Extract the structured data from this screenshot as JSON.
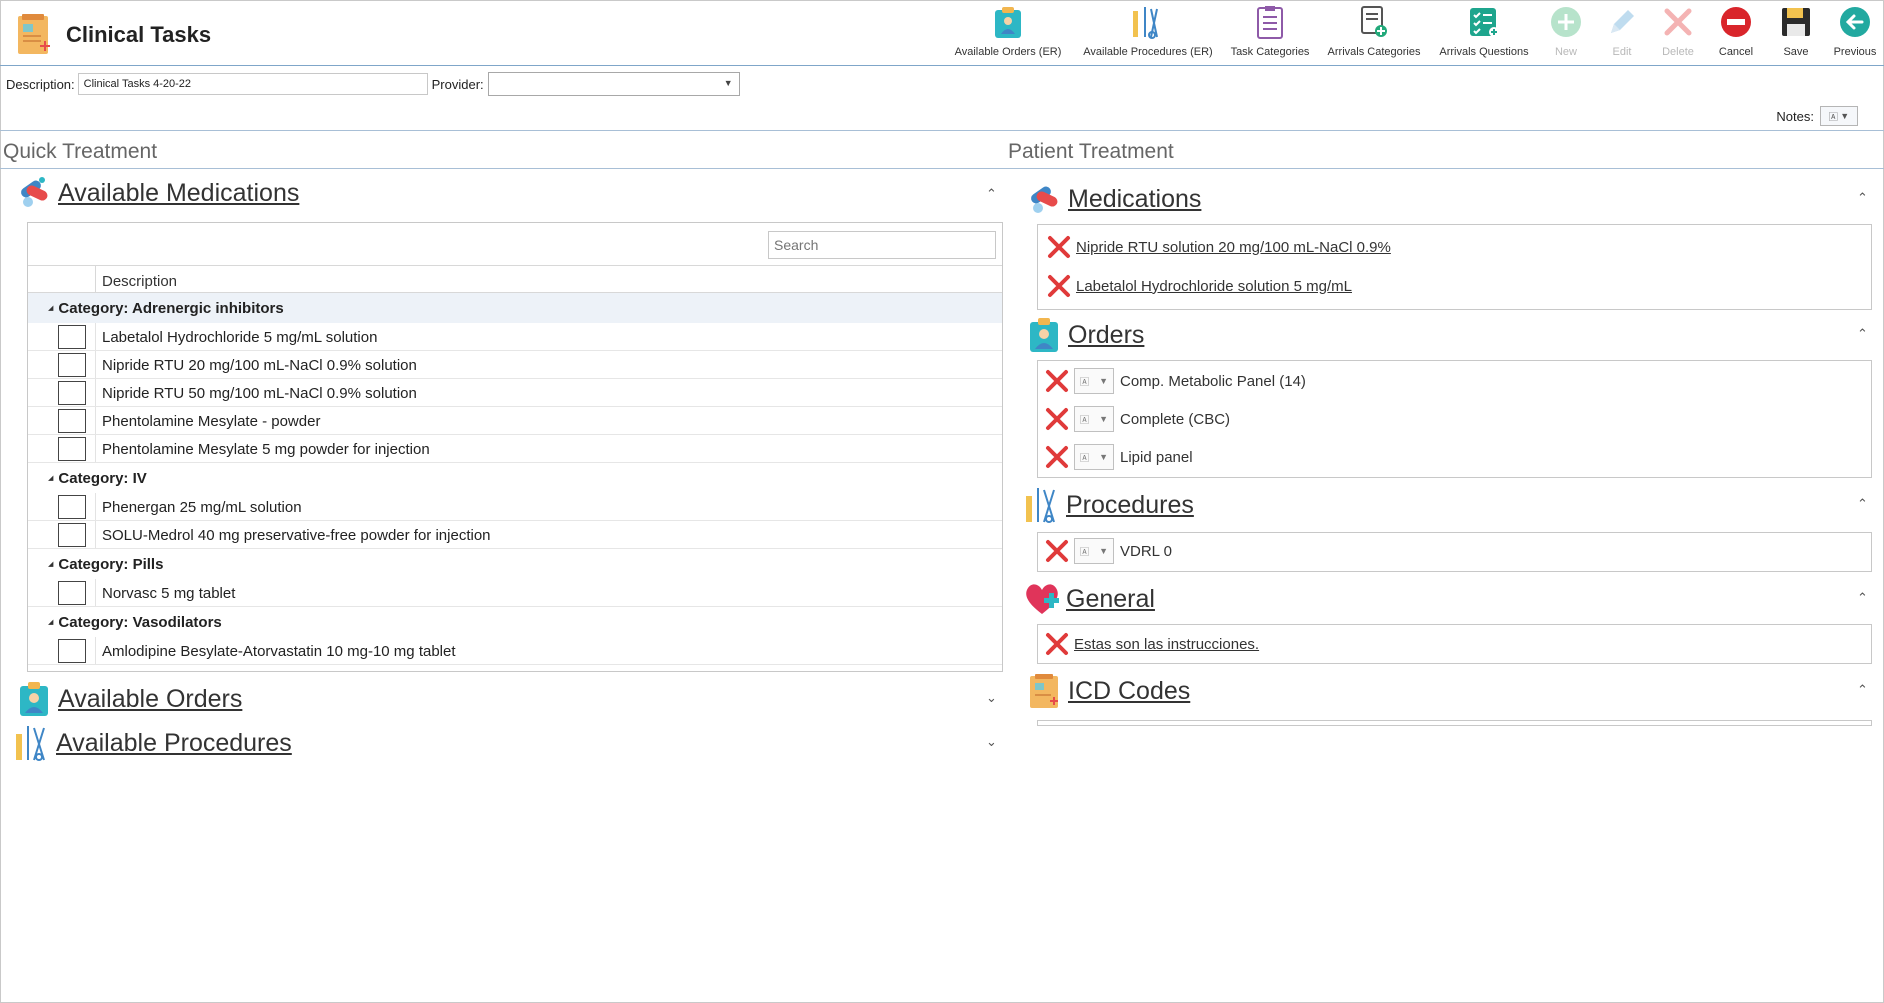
{
  "header": {
    "title": "Clinical Tasks"
  },
  "toolbar": {
    "available_orders": "Available Orders (ER)",
    "available_procedures": "Available Procedures (ER)",
    "task_categories": "Task Categories",
    "arrivals_categories": "Arrivals Categories",
    "arrivals_questions": "Arrivals Questions",
    "new": "New",
    "edit": "Edit",
    "delete": "Delete",
    "cancel": "Cancel",
    "save": "Save",
    "previous": "Previous"
  },
  "form": {
    "description_label": "Description:",
    "description_value": "Clinical Tasks 4-20-22",
    "provider_label": "Provider:",
    "provider_value": "",
    "notes_label": "Notes:"
  },
  "quick_treatment": {
    "title": "Quick Treatment",
    "available_medications": {
      "title": "Available Medications",
      "search_placeholder": "Search",
      "column_description": "Description",
      "categories": [
        {
          "label": "Category: Adrenergic inhibitors",
          "items": [
            "Labetalol Hydrochloride 5 mg/mL solution",
            "Nipride RTU 20 mg/100 mL-NaCl 0.9% solution",
            "Nipride RTU 50 mg/100 mL-NaCl 0.9% solution",
            "Phentolamine Mesylate - powder",
            "Phentolamine Mesylate 5 mg powder for injection"
          ]
        },
        {
          "label": "Category: IV",
          "items": [
            "Phenergan 25 mg/mL solution",
            "SOLU-Medrol 40 mg preservative-free powder for injection"
          ]
        },
        {
          "label": "Category: Pills",
          "items": [
            "Norvasc 5 mg tablet"
          ]
        },
        {
          "label": "Category: Vasodilators",
          "items": [
            "Amlodipine Besylate-Atorvastatin 10 mg-10 mg tablet"
          ]
        }
      ]
    },
    "available_orders": {
      "title": "Available Orders"
    },
    "available_procedures": {
      "title": "Available Procedures"
    }
  },
  "patient_treatment": {
    "title": "Patient Treatment",
    "medications": {
      "title": "Medications",
      "items": [
        "Nipride RTU solution 20 mg/100 mL-NaCl 0.9%",
        "Labetalol Hydrochloride solution 5 mg/mL"
      ]
    },
    "orders": {
      "title": "Orders",
      "items": [
        "Comp. Metabolic Panel (14)",
        "Complete (CBC)",
        "Lipid panel"
      ]
    },
    "procedures": {
      "title": "Procedures",
      "items": [
        "VDRL 0"
      ]
    },
    "general": {
      "title": "General",
      "items": [
        "Estas son las instrucciones."
      ]
    },
    "icd_codes": {
      "title": "ICD Codes"
    }
  },
  "colors": {
    "accent_blue": "#2f78b5",
    "delete_red": "#e03a3a",
    "teal": "#22a9a0",
    "cancel_red": "#d9252b"
  }
}
